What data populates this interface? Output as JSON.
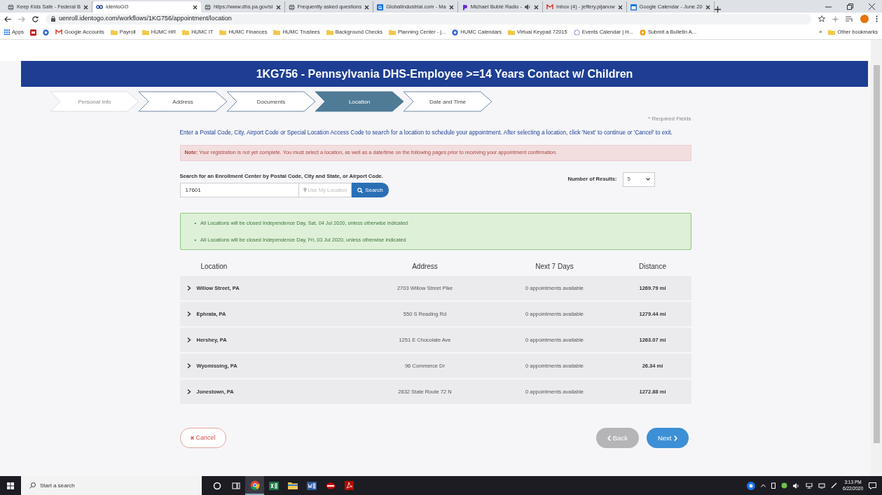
{
  "browser": {
    "tabs": [
      {
        "title": "Keep Kids Safe - Federal B",
        "selected": false,
        "audio": false
      },
      {
        "title": "IdentoGO",
        "selected": true,
        "audio": false
      },
      {
        "title": "https://www.dhs.pa.gov/si",
        "selected": false,
        "audio": false
      },
      {
        "title": "Frequently asked questions",
        "selected": false,
        "audio": false
      },
      {
        "title": "GlobalIndustrial.com - Ma",
        "selected": false,
        "audio": false
      },
      {
        "title": "Michael Bublé Radio -",
        "selected": false,
        "audio": true
      },
      {
        "title": "Inbox (4) - jeffery.pijanow",
        "selected": false,
        "audio": false
      },
      {
        "title": "Google Calendar - June 20",
        "selected": false,
        "audio": false
      }
    ],
    "address": "uenroll.identogo.com/workflows/1KG756/appointment/location",
    "bookmarks": [
      "Apps",
      "Google Accounts",
      "Payroll",
      "HUMC HR",
      "HUMC IT",
      "HUMC Finances",
      "HUMC Trustees",
      "Background Checks",
      "Planning Center - j...",
      "HUMC Calendars",
      "Virtual Keypad 72015",
      "Events Calendar | H...",
      "Submit a Bulletin A..."
    ],
    "more": "»",
    "other_bookmarks": "Other bookmarks"
  },
  "page": {
    "title": "1KG756 - Pennsylvania DHS-Employee >=14 Years Contact w/ Children",
    "steps": [
      {
        "label": "Personal Info",
        "selected": false,
        "faded": true
      },
      {
        "label": "Address",
        "selected": false,
        "faded": false
      },
      {
        "label": "Documents",
        "selected": false,
        "faded": false
      },
      {
        "label": "Location",
        "selected": true,
        "faded": false
      },
      {
        "label": "Date and Time",
        "selected": false,
        "faded": false
      }
    ],
    "required_note": "* Required Fields",
    "intro": "Enter a Postal Code, City, Airport Code or Special Location Access Code to search for a location to schedule your appointment. After selecting a location, click 'Next' to continue or 'Cancel' to exit.",
    "note": "**Note:** Your registration is not yet complete. You must select a location, as well as a date/time on the following pages prior to receiving your appointment confirmation.",
    "search": {
      "label": "Search for an Enrollment Center by Postal Code, City and State, or Airport Code.",
      "value": "17601",
      "location_button": "Use My Location",
      "search_button": "Search"
    },
    "results": {
      "label": "Number of Results:",
      "value": "5"
    },
    "notices": [
      {
        "marker": "•",
        "text": "All Locations will be closed Independence Day, Sat, 04 Jul 2020, unless otherwise indicated"
      },
      {
        "marker": "•",
        "text": "All Locations will be closed Independence Day, Fri, 03 Jul 2020, unless otherwise indicated"
      }
    ],
    "table": {
      "columns": [
        "Location",
        "Address",
        "Next 7 Days",
        "Distance"
      ],
      "rows": [
        {
          "location": "Willow Street, PA",
          "address": "2703 Willow Street Pike",
          "availability": "0 appointments available",
          "distance": "1269.79 mi",
          "expanded": false
        },
        {
          "location": "Ephrata, PA",
          "address": "550 S Reading Rd",
          "availability": "0 appointments available",
          "distance": "1279.44 mi",
          "expanded": false
        },
        {
          "location": "Hershey, PA",
          "address": "1251 E Chocolate Ave",
          "availability": "0 appointments available",
          "distance": "1263.07 mi",
          "expanded": false
        },
        {
          "location": "Wyomissing, PA",
          "address": "96 Commerce Dr",
          "availability": "0 appointments available",
          "distance": "26.34 mi",
          "expanded": false
        },
        {
          "location": "Jonestown, PA",
          "address": "2632 State Route 72 N",
          "availability": "0 appointments available",
          "distance": "1272.88 mi",
          "expanded": false
        }
      ]
    },
    "cancel": "Cancel",
    "back": {
      "label": "Back",
      "disabled": true
    },
    "next": {
      "label": "Next",
      "disabled": false
    }
  },
  "taskbar": {
    "search_placeholder": "Start a search",
    "apps": [
      {
        "active": false
      },
      {
        "active": false
      },
      {
        "active": true
      },
      {
        "active": false
      },
      {
        "active": false
      },
      {
        "active": false
      },
      {
        "active": false
      },
      {
        "active": false
      }
    ],
    "time": "3:13 PM",
    "date": "6/22/2020"
  }
}
